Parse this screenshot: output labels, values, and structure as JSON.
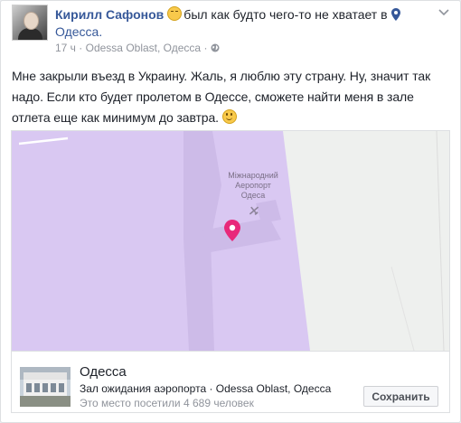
{
  "post": {
    "author": "Кирилл Сафонов",
    "feeling_text": "был как будто чего-то не хватает в",
    "feeling_icon": "confused-face-emoji",
    "location": "Одесса.",
    "time": "17 ч",
    "separator": "·",
    "place_region": "Odessa Oblast, Одесса",
    "privacy_icon": "globe-icon",
    "body": "Мне закрыли въезд в Украину. Жаль, я люблю эту страну. Ну, значит так надо. Если кто будет пролетом в Одессе, сможете найти меня в зале отлета еще как минимум до завтра."
  },
  "map": {
    "label_line1": "Міжнародний",
    "label_line2": "Аеропорт",
    "label_line3": "Одеса",
    "colors": {
      "airport": "#d9c8f2",
      "land": "#eef0ee",
      "marker": "#e8287a"
    }
  },
  "place_card": {
    "name": "Одесса",
    "subtitle": "Зал ожидания аэропорта · Odessa Oblast, Одесса",
    "visits": "Это место посетили 4 689 человек",
    "save_label": "Сохранить"
  },
  "colors": {
    "link": "#365899",
    "muted": "#90949c"
  }
}
